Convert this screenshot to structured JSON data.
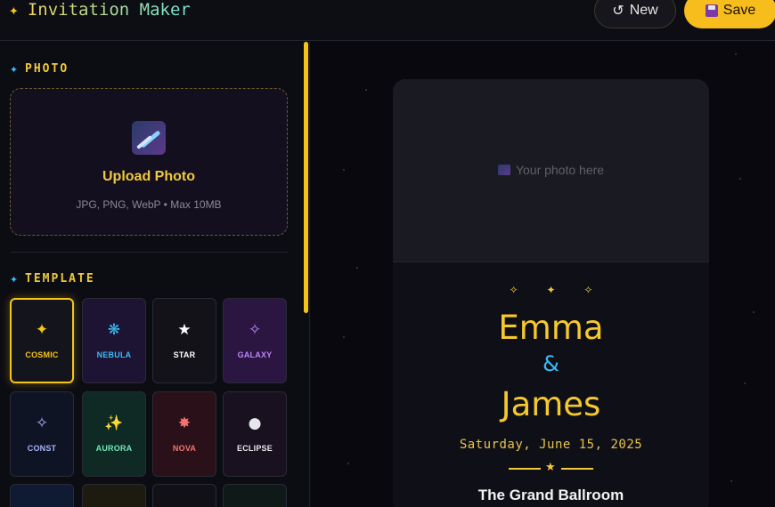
{
  "app": {
    "title": "Invitation Maker",
    "title_icon": "sparkle-icon"
  },
  "header": {
    "new_label": "New",
    "new_icon": "↺",
    "save_label": "Save"
  },
  "photo_section": {
    "title": "PHOTO",
    "upload_label": "Upload Photo",
    "upload_hint": "JPG, PNG, WebP • Max 10MB"
  },
  "template_section": {
    "title": "TEMPLATE",
    "templates": [
      {
        "name": "COSMIC",
        "glyph": "✦",
        "color": "#f5c518",
        "bg": "#14141c",
        "selected": true
      },
      {
        "name": "NEBULA",
        "glyph": "❋",
        "color": "#38bdf8",
        "bg": "#1d1433",
        "selected": false
      },
      {
        "name": "STAR",
        "glyph": "★",
        "color": "#ffffff",
        "bg": "#121218",
        "selected": false
      },
      {
        "name": "GALAXY",
        "glyph": "✧",
        "color": "#c084fc",
        "bg": "#2a1640",
        "selected": false
      },
      {
        "name": "CONST",
        "glyph": "✧",
        "color": "#a5b4fc",
        "bg": "#0f1424",
        "selected": false
      },
      {
        "name": "AURORA",
        "glyph": "✨",
        "color": "#6ee7b7",
        "bg": "#0f2a24",
        "selected": false
      },
      {
        "name": "NOVA",
        "glyph": "✸",
        "color": "#f87171",
        "bg": "#2a1018",
        "selected": false
      },
      {
        "name": "ECLIPSE",
        "glyph": "●",
        "color": "#e5e7eb",
        "bg": "#1a1120",
        "selected": false
      }
    ]
  },
  "preview": {
    "photo_placeholder": "Your photo here",
    "stars": "✧ ✦ ✧",
    "name1": "Emma",
    "ampersand": "&",
    "name2": "James",
    "date": "Saturday, June 15, 2025",
    "venue": "The Grand Ballroom"
  }
}
